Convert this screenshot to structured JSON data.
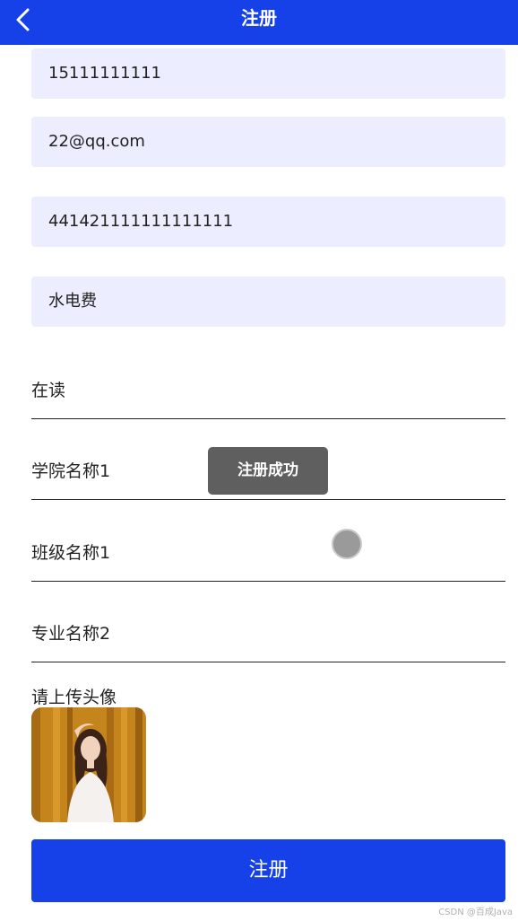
{
  "header": {
    "title": "注册",
    "back_icon": "chevron-left-icon"
  },
  "form": {
    "phone": "15111111111",
    "email": "22@qq.com",
    "id_number": "441421111111111111",
    "field4": "水电费",
    "status": "在读",
    "college": "学院名称1",
    "class_name": "班级名称1",
    "major": "专业名称2",
    "avatar_label": "请上传头像",
    "submit_label": "注册"
  },
  "toast": {
    "message": "注册成功"
  },
  "watermark": "CSDN @百成Java",
  "colors": {
    "primary": "#1640e8",
    "input_bg": "#eceeff",
    "toast_bg": "#5f5f5f"
  }
}
